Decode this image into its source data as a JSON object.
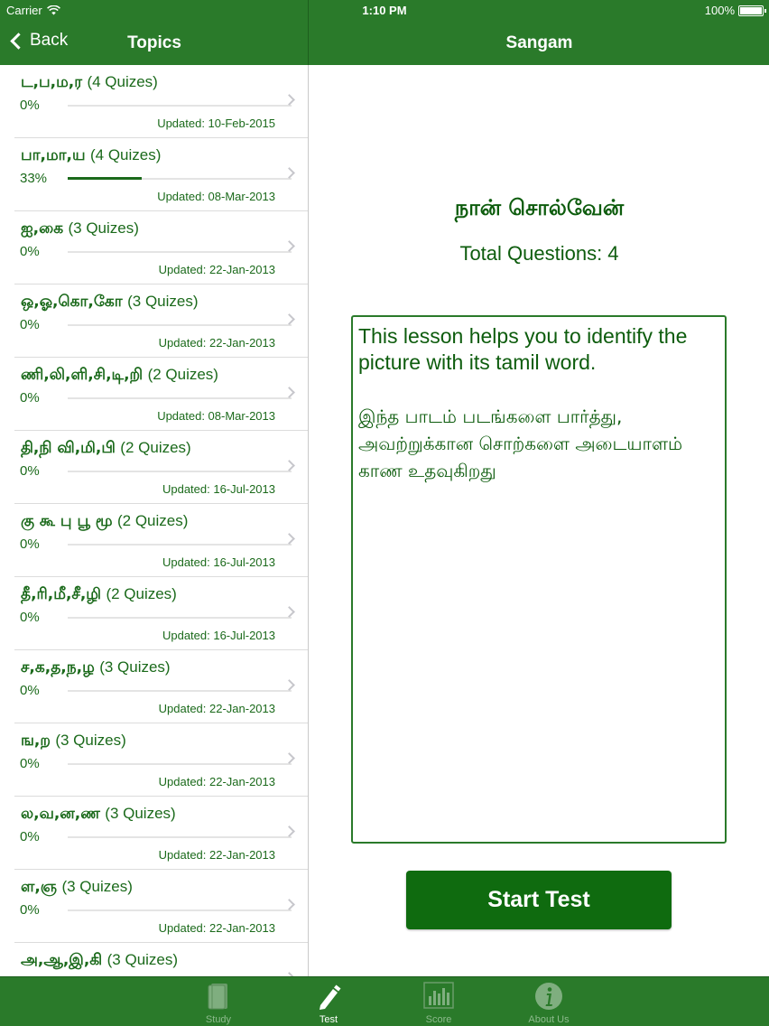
{
  "status_bar": {
    "carrier": "Carrier",
    "time": "1:10 PM",
    "battery": "100%"
  },
  "nav_left": {
    "back_label": "Back",
    "title": "Topics"
  },
  "nav_right": {
    "title": "Sangam"
  },
  "topics": [
    {
      "tamil": "ட,ப,ம,ர",
      "quizzes": "(4 Quizes)",
      "progress": "0%",
      "progress_value": 0,
      "updated": "Updated: 10-Feb-2015"
    },
    {
      "tamil": "பா,மா,ய",
      "quizzes": "(4 Quizes)",
      "progress": "33%",
      "progress_value": 33,
      "updated": "Updated: 08-Mar-2013"
    },
    {
      "tamil": "ஐ,கை",
      "quizzes": "(3 Quizes)",
      "progress": "0%",
      "progress_value": 0,
      "updated": "Updated: 22-Jan-2013"
    },
    {
      "tamil": "ஒ,ஓ,கொ,கோ",
      "quizzes": "(3 Quizes)",
      "progress": "0%",
      "progress_value": 0,
      "updated": "Updated: 22-Jan-2013"
    },
    {
      "tamil": "ணி,லி,ளி,சி,டி,றி",
      "quizzes": "(2 Quizes)",
      "progress": "0%",
      "progress_value": 0,
      "updated": "Updated: 08-Mar-2013"
    },
    {
      "tamil": "தி,நி வி,மி,பி",
      "quizzes": "(2 Quizes)",
      "progress": "0%",
      "progress_value": 0,
      "updated": "Updated: 16-Jul-2013"
    },
    {
      "tamil": "கு கூ பு பூ மூ",
      "quizzes": "(2 Quizes)",
      "progress": "0%",
      "progress_value": 0,
      "updated": "Updated: 16-Jul-2013"
    },
    {
      "tamil": "தீ,ரி,மீ,சீ,ழி",
      "quizzes": "(2 Quizes)",
      "progress": "0%",
      "progress_value": 0,
      "updated": "Updated: 16-Jul-2013"
    },
    {
      "tamil": "ச,க,த,ந,ழ",
      "quizzes": "(3 Quizes)",
      "progress": "0%",
      "progress_value": 0,
      "updated": "Updated: 22-Jan-2013"
    },
    {
      "tamil": "ங,ற",
      "quizzes": "(3 Quizes)",
      "progress": "0%",
      "progress_value": 0,
      "updated": "Updated: 22-Jan-2013"
    },
    {
      "tamil": "ல,வ,ன,ண",
      "quizzes": "(3 Quizes)",
      "progress": "0%",
      "progress_value": 0,
      "updated": "Updated: 22-Jan-2013"
    },
    {
      "tamil": "ள,ஞ",
      "quizzes": "(3 Quizes)",
      "progress": "0%",
      "progress_value": 0,
      "updated": "Updated: 22-Jan-2013"
    },
    {
      "tamil": "அ,ஆ,இ,கி",
      "quizzes": "(3 Quizes)",
      "progress": "",
      "progress_value": 0,
      "updated": ""
    }
  ],
  "detail": {
    "title": "நான் சொல்வேன்",
    "total_questions": "Total Questions: 4",
    "description_en": "This lesson helps you to identify the picture with its tamil word.",
    "description_ta": "இந்த பாடம் படங்களை பார்த்து, அவற்றுக்கான சொற்களை அடையாளம் காண உதவுகிறது",
    "start_button": "Start Test"
  },
  "tabs": [
    {
      "label": "Study",
      "icon": "book-icon",
      "active": false
    },
    {
      "label": "Test",
      "icon": "pencil-icon",
      "active": true
    },
    {
      "label": "Score",
      "icon": "bar-chart-icon",
      "active": false
    },
    {
      "label": "About Us",
      "icon": "info-icon",
      "active": false
    }
  ],
  "colors": {
    "brand_green": "#2a7a2a",
    "text_green": "#0d5c0d",
    "button_green": "#0f6b0f"
  }
}
